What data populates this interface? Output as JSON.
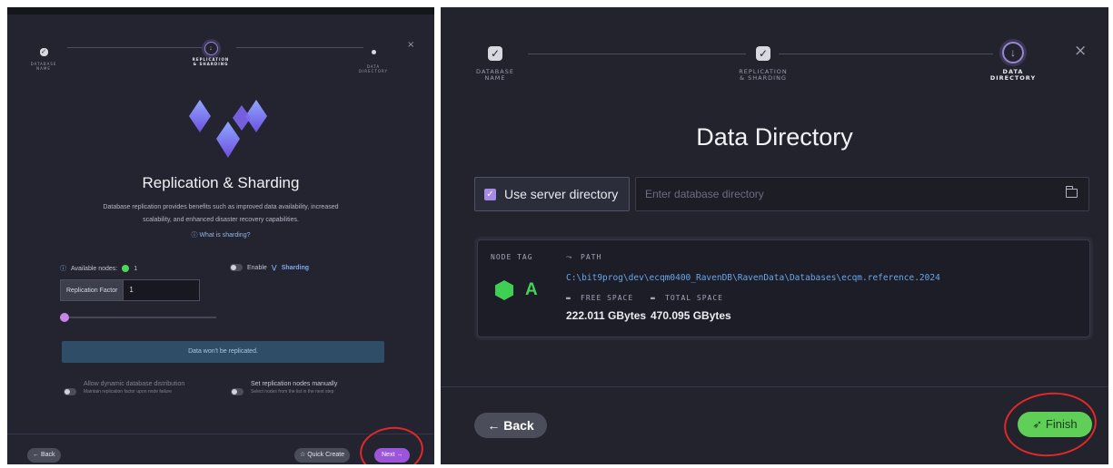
{
  "left": {
    "steps": [
      {
        "label": "DATABASE\nNAME"
      },
      {
        "label": "REPLICATION\n& SHARDING"
      },
      {
        "label": "DATA\nDIRECTORY"
      }
    ],
    "title": "Replication & Sharding",
    "description": "Database replication provides benefits such as improved data availability, increased scalability, and enhanced disaster recovery capabilities.",
    "what_is_sharding": "What is sharding?",
    "available_nodes_label": "Available nodes:",
    "available_nodes_count": "1",
    "enable_label": "Enable",
    "sharding_label": "Sharding",
    "replication_factor_label": "Replication Factor",
    "replication_factor_value": "1",
    "not_replicated": "Data won't be replicated.",
    "dynamic_distribution": {
      "title": "Allow dynamic database distribution",
      "subtitle": "Maintain replication factor upon node failure"
    },
    "manual_nodes": {
      "title": "Set replication nodes manually",
      "subtitle": "Select nodes from the list in the next step"
    },
    "back_label": "Back",
    "quick_create_label": "Quick Create",
    "next_label": "Next"
  },
  "right": {
    "steps": [
      {
        "label": "DATABASE\nNAME"
      },
      {
        "label": "REPLICATION\n& SHARDING"
      },
      {
        "label": "DATA\nDIRECTORY"
      }
    ],
    "title": "Data Directory",
    "use_server_directory_label": "Use server directory",
    "directory_placeholder": "Enter database directory",
    "node_tag_label": "NODE TAG",
    "node_tag": "A",
    "path_label": "PATH",
    "path_value": "C:\\bit9prog\\dev\\ecqm0400_RavenDB\\RavenData\\Databases\\ecqm.reference.2024",
    "free_space_label": "FREE SPACE",
    "free_space_value": "222.011 GBytes",
    "total_space_label": "TOTAL SPACE",
    "total_space_value": "470.095 GBytes",
    "back_label": "Back",
    "finish_label": "Finish"
  },
  "colors": {
    "accent_purple": "#9a55d9",
    "finish_green": "#5fcf57",
    "node_green": "#3fcf55",
    "annotation_red": "#e2282b"
  }
}
